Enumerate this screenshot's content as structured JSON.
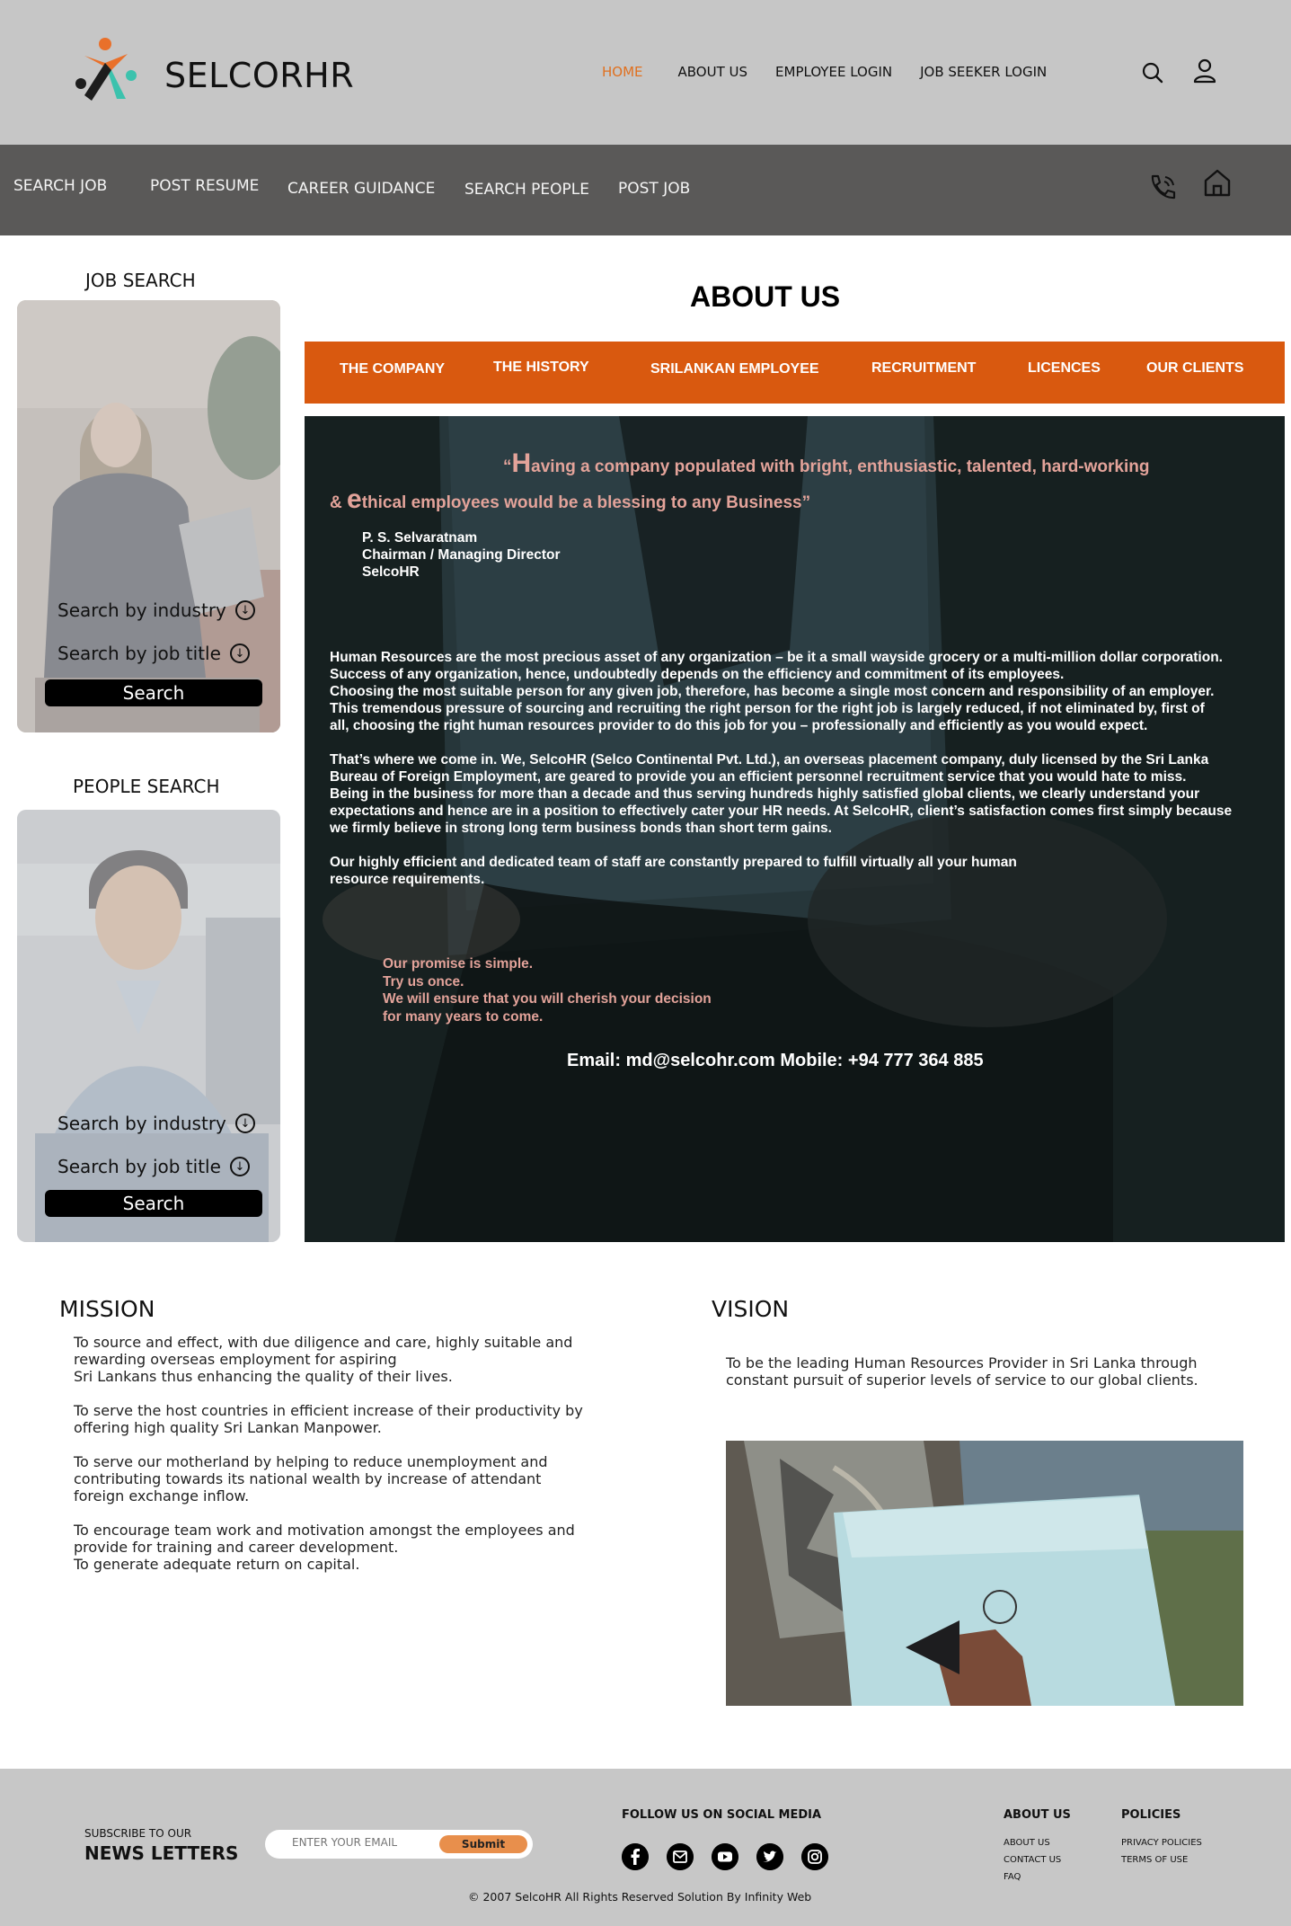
{
  "brand": {
    "name": "SELCORHR"
  },
  "top_nav": [
    {
      "label": "HOME",
      "active": true
    },
    {
      "label": "ABOUT US",
      "active": false
    },
    {
      "label": "EMPLOYEE LOGIN",
      "active": false
    },
    {
      "label": "JOB SEEKER LOGIN",
      "active": false
    }
  ],
  "header_icons": [
    "search-icon",
    "user-icon"
  ],
  "sub_nav": [
    {
      "label": "SEARCH JOB"
    },
    {
      "label": "POST RESUME"
    },
    {
      "label": "CAREER GUIDANCE"
    },
    {
      "label": "SEARCH PEOPLE"
    },
    {
      "label": "POST JOB"
    }
  ],
  "sub_nav_icons": [
    "phone-icon",
    "home-icon"
  ],
  "job_search": {
    "title": "JOB SEARCH",
    "option_industry": "Search by industry",
    "option_job_title": "Search by job title",
    "button": "Search"
  },
  "people_search": {
    "title": "PEOPLE SEARCH",
    "option_industry": "Search by industry",
    "option_job_title": "Search by job title",
    "button": "Search"
  },
  "about": {
    "title": "ABOUT US",
    "tabs": [
      "THE COMPANY",
      "THE HISTORY",
      "SRILANKAN EMPLOYEE",
      "RECRUITMENT",
      "LICENCES",
      "OUR CLIENTS"
    ],
    "quote_line1_open": "“",
    "quote_line1_cap": "H",
    "quote_line1_rest": "aving a company populated with bright, enthusiastic, talented, hard-working",
    "quote_line2_pre": "& ",
    "quote_line2_cap": "e",
    "quote_line2_rest": "thical employees would be a blessing to any Business”",
    "signature": "P. S. Selvaratnam\nChairman / Managing Director\nSelcoHR",
    "paragraph1": " Human Resources are the most precious asset of any organization – be it a small wayside grocery or a multi-million dollar  corporation.\n Success of any organization, hence, undoubtedly depends on the efficiency and commitment of its employees.\nChoosing the most suitable person for any given job, therefore, has become a single most concern and responsibility of an employer.\nThis tremendous pressure of sourcing and recruiting the right person for the right job is largely reduced, if not eliminated by, first of\nall, choosing the right human resources provider to do this job for you – professionally and efficiently as you would expect.",
    "paragraph2": "That’s where we come in. We, SelcoHR (Selco Continental Pvt. Ltd.), an overseas placement company, duly licensed by the Sri Lanka\nBureau of Foreign  Employment, are geared to provide you an efficient personnel recruitment service that you would hate to miss.\nBeing in the business for more than a decade and thus serving hundreds highly satisfied global clients, we clearly understand your\nexpectations and hence are in a position to effectively cater your HR needs. At SelcoHR, client’s satisfaction comes first simply because\nwe firmly believe in strong long term business bonds than short term gains.",
    "paragraph3": "Our highly efficient and dedicated team of staff are constantly prepared to fulfill virtually all your human\nresource requirements.",
    "promise": " Our promise is simple.\nTry us once.\nWe will ensure that you will cherish your decision\nfor many years to come.",
    "contact": "Email: md@selcohr.com Mobile: +94 777 364 885"
  },
  "mission": {
    "title": "MISSION",
    "p1": "To source and effect, with due diligence and care, highly suitable and\nrewarding overseas employment for aspiring\n Sri Lankans thus enhancing the quality of their lives.",
    "p2": "To serve the host countries in efficient increase of their productivity by\noffering high quality Sri Lankan Manpower.",
    "p3": "To serve our motherland by helping to reduce unemployment and\ncontributing towards its national wealth by increase of attendant\nforeign exchange inflow.",
    "p4": "To encourage team work and motivation amongst the employees and\nprovide for training and career development.\nTo generate adequate return on capital."
  },
  "vision": {
    "title": "VISION",
    "text": "To be the leading Human Resources Provider in Sri Lanka through\nconstant pursuit of superior levels of service to our global clients."
  },
  "footer": {
    "subscribe_small": "SUBSCRIBE TO OUR",
    "subscribe_big": "NEWS LETTERS",
    "email_placeholder": "ENTER YOUR EMAIL",
    "submit": "Submit",
    "social_title": "FOLLOW US ON SOCIAL MEDIA",
    "social_icons": [
      "facebook-icon",
      "mail-icon",
      "youtube-icon",
      "twitter-icon",
      "instagram-icon"
    ],
    "about_title": "ABOUT US",
    "about_links": [
      "ABOUT US",
      "CONTACT US",
      "FAQ"
    ],
    "policies_title": "POLICIES",
    "policies_links": [
      "PRIVACY POLICIES",
      "TERMS OF  USE"
    ],
    "copyright": "© 2007 SelcoHR All Rights Reserved Solution By Infinity Web"
  },
  "colors": {
    "accent": "#d9590f",
    "nav_active": "#e0701f",
    "header_bg": "#c6c6c6",
    "subnav_bg": "#5a5958",
    "quote_pink": "#e3a39a",
    "submit_orange": "#e88f4c"
  }
}
